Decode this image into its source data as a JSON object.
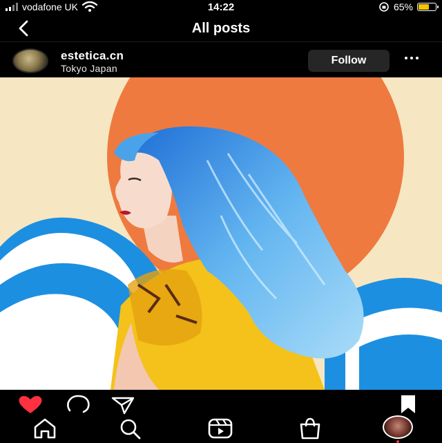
{
  "status_bar": {
    "carrier": "vodafone UK",
    "time": "14:22",
    "battery": "65%",
    "battery_level": 0.65
  },
  "header": {
    "title": "All posts"
  },
  "post": {
    "username": "estetica.cn",
    "location": "Tokyo Japan",
    "follow_label": "Follow",
    "liked": true
  },
  "icons": {
    "back": "chevron-left-icon",
    "more": "more-horizontal-icon",
    "like": "heart-icon",
    "comment": "comment-icon",
    "share": "send-icon",
    "save": "bookmark-icon",
    "home": "home-icon",
    "search": "search-icon",
    "reels": "reels-icon",
    "shop": "shop-icon",
    "profile": "profile-avatar"
  },
  "colors": {
    "like": "#ff3040",
    "battery": "#f5c400",
    "follow_bg": "#262626"
  }
}
